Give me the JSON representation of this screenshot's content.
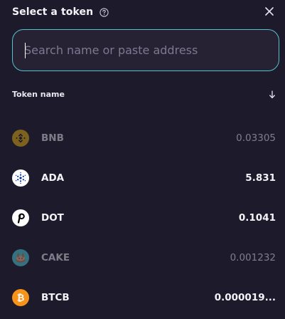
{
  "header": {
    "title": "Select a token",
    "help_icon": "question-circle-icon",
    "close_icon": "close-icon"
  },
  "search": {
    "placeholder": "Search name or paste address",
    "value": "",
    "border_color": "#52c3d0"
  },
  "list": {
    "column_label": "Token name",
    "sort_icon": "arrow-down-icon",
    "tokens": [
      {
        "symbol": "BNB",
        "balance": "0.03305",
        "enabled": false,
        "icon": "bnb-logo-icon",
        "color": "#f0b90b"
      },
      {
        "symbol": "ADA",
        "balance": "5.831",
        "enabled": true,
        "icon": "cardano-logo-icon",
        "color": "#0033ad"
      },
      {
        "symbol": "DOT",
        "balance": "0.1041",
        "enabled": true,
        "icon": "polkadot-logo-icon",
        "color": "#000000"
      },
      {
        "symbol": "CAKE",
        "balance": "0.001232",
        "enabled": false,
        "icon": "pancakeswap-logo-icon",
        "color": "#633001"
      },
      {
        "symbol": "BTCB",
        "balance": "0.000019...",
        "enabled": true,
        "icon": "bitcoin-logo-icon",
        "color": "#f7931a"
      }
    ]
  }
}
